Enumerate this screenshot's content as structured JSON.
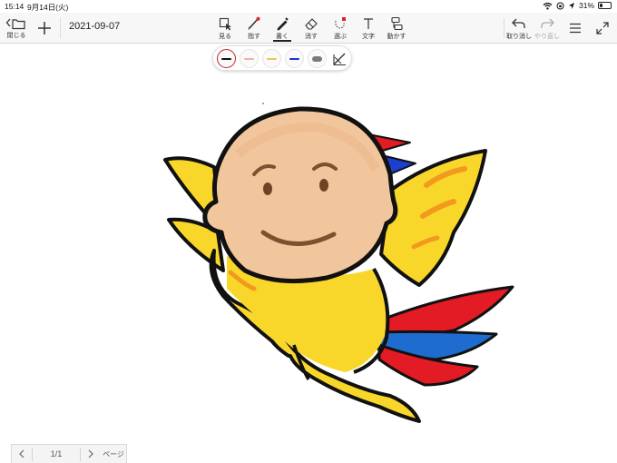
{
  "status_bar": {
    "time": "15:14",
    "date": "9月14日(火)",
    "battery": "31%",
    "battery_level": 0.31
  },
  "toolbar": {
    "close_label": "閉じる",
    "doc_title": "2021-09-07",
    "tools": [
      {
        "label": "見る",
        "icon": "view-icon"
      },
      {
        "label": "指す",
        "icon": "pointer-icon"
      },
      {
        "label": "書く",
        "icon": "pen-icon",
        "active": true
      },
      {
        "label": "消す",
        "icon": "eraser-icon"
      },
      {
        "label": "選ぶ",
        "icon": "select-icon"
      },
      {
        "label": "文字",
        "icon": "text-icon"
      },
      {
        "label": "動かす",
        "icon": "move-icon"
      }
    ],
    "undo_label": "取り消し",
    "redo_label": "やり直し"
  },
  "palette": {
    "pens": [
      {
        "color": "#111111",
        "selected": true
      },
      {
        "color": "#f3b0a8"
      },
      {
        "color": "#f0c64a"
      },
      {
        "color": "#1a33d6"
      },
      {
        "color": "#7a7a7a"
      }
    ]
  },
  "page_nav": {
    "current": "1/1",
    "page_label": "ページ"
  }
}
